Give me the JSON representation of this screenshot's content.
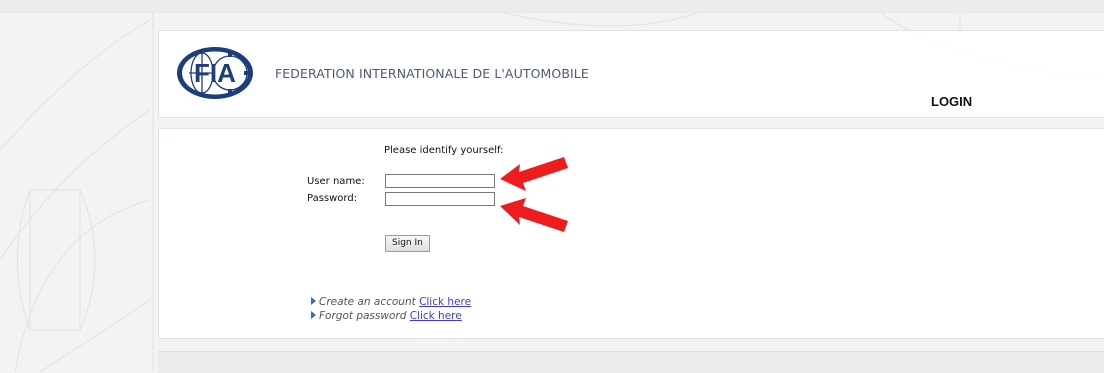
{
  "header": {
    "org_name": "FEDERATION INTERNATIONALE DE L'AUTOMOBILE",
    "logo_text": "FIA",
    "page_title": "LOGIN"
  },
  "form": {
    "prompt": "Please identify yourself:",
    "username_label": "User name:",
    "username_value": "",
    "password_label": "Password:",
    "password_value": "",
    "signin_label": "Sign In"
  },
  "links": [
    {
      "text": "Create an account",
      "link_label": "Click here"
    },
    {
      "text": "Forgot password",
      "link_label": "Click here"
    }
  ],
  "colors": {
    "brand_blue": "#1d3e7a",
    "link_blue": "#3b3bd8",
    "annotation_red": "#ee1c1c"
  }
}
